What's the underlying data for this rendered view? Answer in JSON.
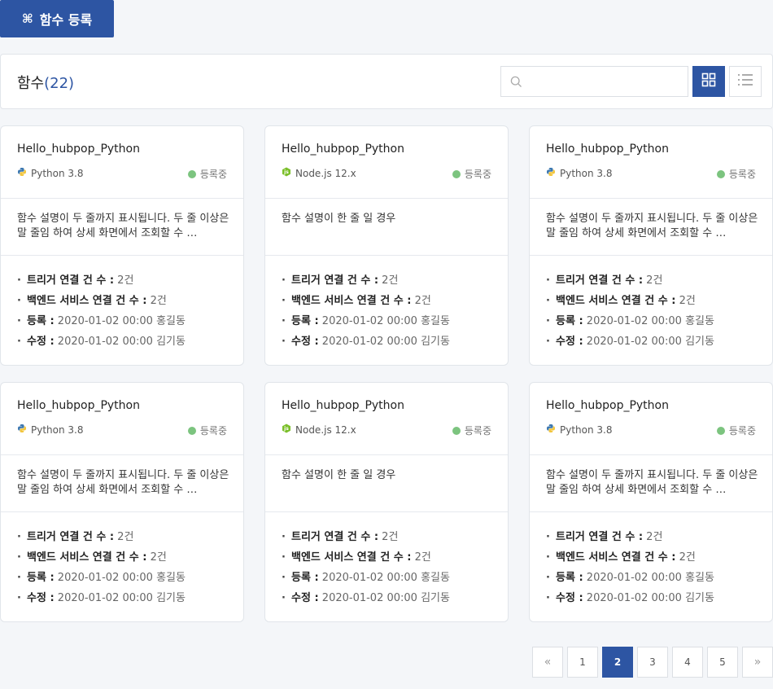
{
  "toolbar": {
    "register_icon": "⌘",
    "register_label": "함수 등록"
  },
  "header": {
    "title": "함수",
    "count": "(22)",
    "search": {
      "placeholder": "",
      "value": ""
    },
    "view_modes": [
      "grid",
      "list"
    ]
  },
  "colors": {
    "accent": "#2d55a3",
    "status_active": "#7cc47f"
  },
  "cards": [
    {
      "name": "Hello_hubpop_Python",
      "runtime": {
        "icon": "python-icon",
        "label": "Python 3.8"
      },
      "status": "등록중",
      "description": "함수 설명이 두 줄까지 표시됩니다. 두 줄 이상은 말 줄임 하여 상세 화면에서 조회할 수 …",
      "info": [
        {
          "label": "트리거 연결  건 수 :",
          "value": "2건"
        },
        {
          "label": "백엔드 서비스 연결 건 수 :",
          "value": "2건"
        },
        {
          "label": "등록 :",
          "value": "2020-01-02 00:00 홍길동"
        },
        {
          "label": "수정 :",
          "value": "2020-01-02 00:00 김기동"
        }
      ]
    },
    {
      "name": "Hello_hubpop_Python",
      "runtime": {
        "icon": "nodejs-icon",
        "label": "Node.js 12.x"
      },
      "status": "등록중",
      "description": "함수 설명이 한 줄 일 경우",
      "info": [
        {
          "label": "트리거 연결  건 수 :",
          "value": "2건"
        },
        {
          "label": "백엔드 서비스 연결 건 수 :",
          "value": "2건"
        },
        {
          "label": "등록 :",
          "value": "2020-01-02 00:00 홍길동"
        },
        {
          "label": "수정 :",
          "value": "2020-01-02 00:00 김기동"
        }
      ]
    },
    {
      "name": "Hello_hubpop_Python",
      "runtime": {
        "icon": "python-icon",
        "label": "Python 3.8"
      },
      "status": "등록중",
      "description": "함수 설명이 두 줄까지 표시됩니다. 두 줄 이상은 말 줄임 하여 상세 화면에서 조회할 수 …",
      "info": [
        {
          "label": "트리거 연결  건 수 :",
          "value": "2건"
        },
        {
          "label": "백엔드 서비스 연결 건 수 :",
          "value": "2건"
        },
        {
          "label": "등록 :",
          "value": "2020-01-02 00:00 홍길동"
        },
        {
          "label": "수정 :",
          "value": "2020-01-02 00:00 김기동"
        }
      ]
    },
    {
      "name": "Hello_hubpop_Python",
      "runtime": {
        "icon": "python-icon",
        "label": "Python 3.8"
      },
      "status": "등록중",
      "description": "함수 설명이 두 줄까지 표시됩니다. 두 줄 이상은 말 줄임 하여 상세 화면에서 조회할 수 …",
      "info": [
        {
          "label": "트리거 연결  건 수 :",
          "value": "2건"
        },
        {
          "label": "백엔드 서비스 연결 건 수 :",
          "value": "2건"
        },
        {
          "label": "등록 :",
          "value": "2020-01-02 00:00 홍길동"
        },
        {
          "label": "수정 :",
          "value": "2020-01-02 00:00 김기동"
        }
      ]
    },
    {
      "name": "Hello_hubpop_Python",
      "runtime": {
        "icon": "nodejs-icon",
        "label": "Node.js 12.x"
      },
      "status": "등록중",
      "description": "함수 설명이 한 줄 일 경우",
      "info": [
        {
          "label": "트리거 연결  건 수 :",
          "value": "2건"
        },
        {
          "label": "백엔드 서비스 연결 건 수 :",
          "value": "2건"
        },
        {
          "label": "등록 :",
          "value": "2020-01-02 00:00 홍길동"
        },
        {
          "label": "수정 :",
          "value": "2020-01-02 00:00 김기동"
        }
      ]
    },
    {
      "name": "Hello_hubpop_Python",
      "runtime": {
        "icon": "python-icon",
        "label": "Python 3.8"
      },
      "status": "등록중",
      "description": "함수 설명이 두 줄까지 표시됩니다. 두 줄 이상은 말 줄임 하여 상세 화면에서 조회할 수 …",
      "info": [
        {
          "label": "트리거 연결  건 수 :",
          "value": "2건"
        },
        {
          "label": "백엔드 서비스 연결 건 수 :",
          "value": "2건"
        },
        {
          "label": "등록 :",
          "value": "2020-01-02 00:00 홍길동"
        },
        {
          "label": "수정 :",
          "value": "2020-01-02 00:00 김기동"
        }
      ]
    }
  ],
  "pagination": {
    "first": "«",
    "last": "»",
    "pages": [
      "1",
      "2",
      "3",
      "4",
      "5"
    ],
    "current": "2"
  }
}
